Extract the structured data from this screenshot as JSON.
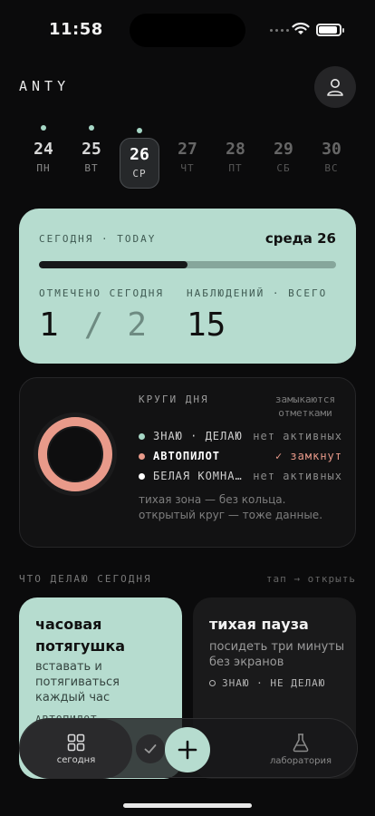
{
  "status_bar": {
    "time": "11:58"
  },
  "header": {
    "brand": "ANTY"
  },
  "days": [
    {
      "num": "24",
      "wd": "ПН",
      "has_dot": true,
      "state": "past"
    },
    {
      "num": "25",
      "wd": "ВТ",
      "has_dot": true,
      "state": "past"
    },
    {
      "num": "26",
      "wd": "СР",
      "has_dot": true,
      "state": "active"
    },
    {
      "num": "27",
      "wd": "ЧТ",
      "has_dot": false,
      "state": "future"
    },
    {
      "num": "28",
      "wd": "ПТ",
      "has_dot": false,
      "state": "future"
    },
    {
      "num": "29",
      "wd": "СБ",
      "has_dot": false,
      "state": "future"
    },
    {
      "num": "30",
      "wd": "ВС",
      "has_dot": false,
      "state": "future"
    }
  ],
  "today_card": {
    "label": "СЕГОДНЯ · TODAY",
    "date": "среда 26",
    "progress": 0.5,
    "marked_label": "ОТМЕЧЕНО СЕГОДНЯ",
    "marked_done": "1",
    "marked_sep": "/",
    "marked_total": "2",
    "observations_label": "НАБЛЮДЕНИЙ · ВСЕГО",
    "observations_value": "15"
  },
  "circles_card": {
    "title": "КРУГИ ДНЯ",
    "subtitle": "замыкаются отметками",
    "rows": [
      {
        "name": "ЗНАЮ · ДЕЛАЮ",
        "status": "нет активных",
        "color": "#a6d7c6"
      },
      {
        "name": "АВТОПИЛОТ",
        "status": "✓ замкнут",
        "color": "#e99a8a"
      },
      {
        "name": "БЕЛАЯ КОМНА…",
        "status": "нет активных",
        "color": "#ffffff"
      }
    ],
    "note": "тихая зона — без кольца. открытый круг — тоже данные."
  },
  "section": {
    "title": "ЧТО ДЕЛАЮ СЕГОДНЯ",
    "hint": "тап → открыть"
  },
  "cards": [
    {
      "title": "часовая потягушка",
      "desc": "вставать и потягиваться каждый час",
      "tag": "АВТОПИЛОТ"
    },
    {
      "title": "тихая пауза",
      "desc": "посидеть три минуты без экранов",
      "tag": "ЗНАЮ · НЕ ДЕЛАЮ"
    }
  ],
  "tabbar": {
    "home_label": "сегодня",
    "lab_label": "лаборатория"
  },
  "colors": {
    "accent": "#b6dccf",
    "ring": "#e99a8a",
    "background": "#0b0b0c"
  }
}
